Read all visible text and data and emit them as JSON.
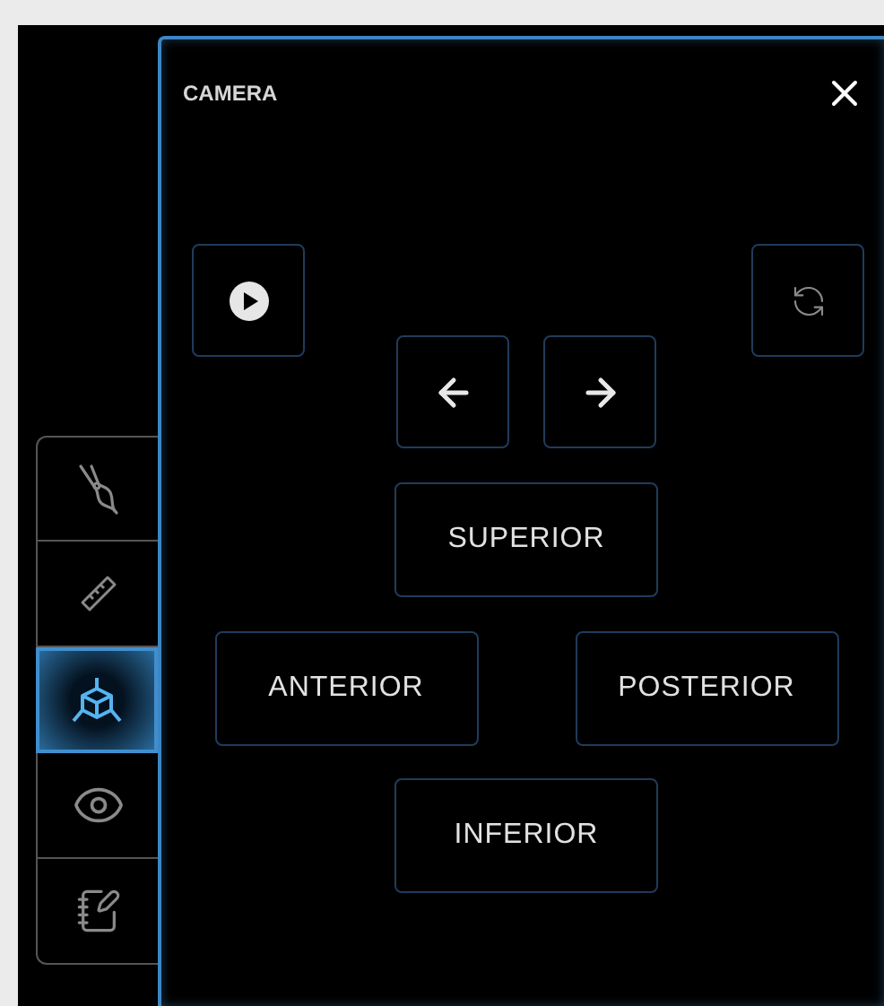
{
  "sidebar": {
    "tabs": [
      {
        "kind": "pliers",
        "selected": false
      },
      {
        "kind": "ruler",
        "selected": false
      },
      {
        "kind": "camera",
        "selected": true
      },
      {
        "kind": "eye",
        "selected": false
      },
      {
        "kind": "notes",
        "selected": false
      }
    ]
  },
  "panel": {
    "title": "CAMERA",
    "views": {
      "top": "SUPERIOR",
      "left": "ANTERIOR",
      "right": "POSTERIOR",
      "bottom": "INFERIOR"
    }
  }
}
